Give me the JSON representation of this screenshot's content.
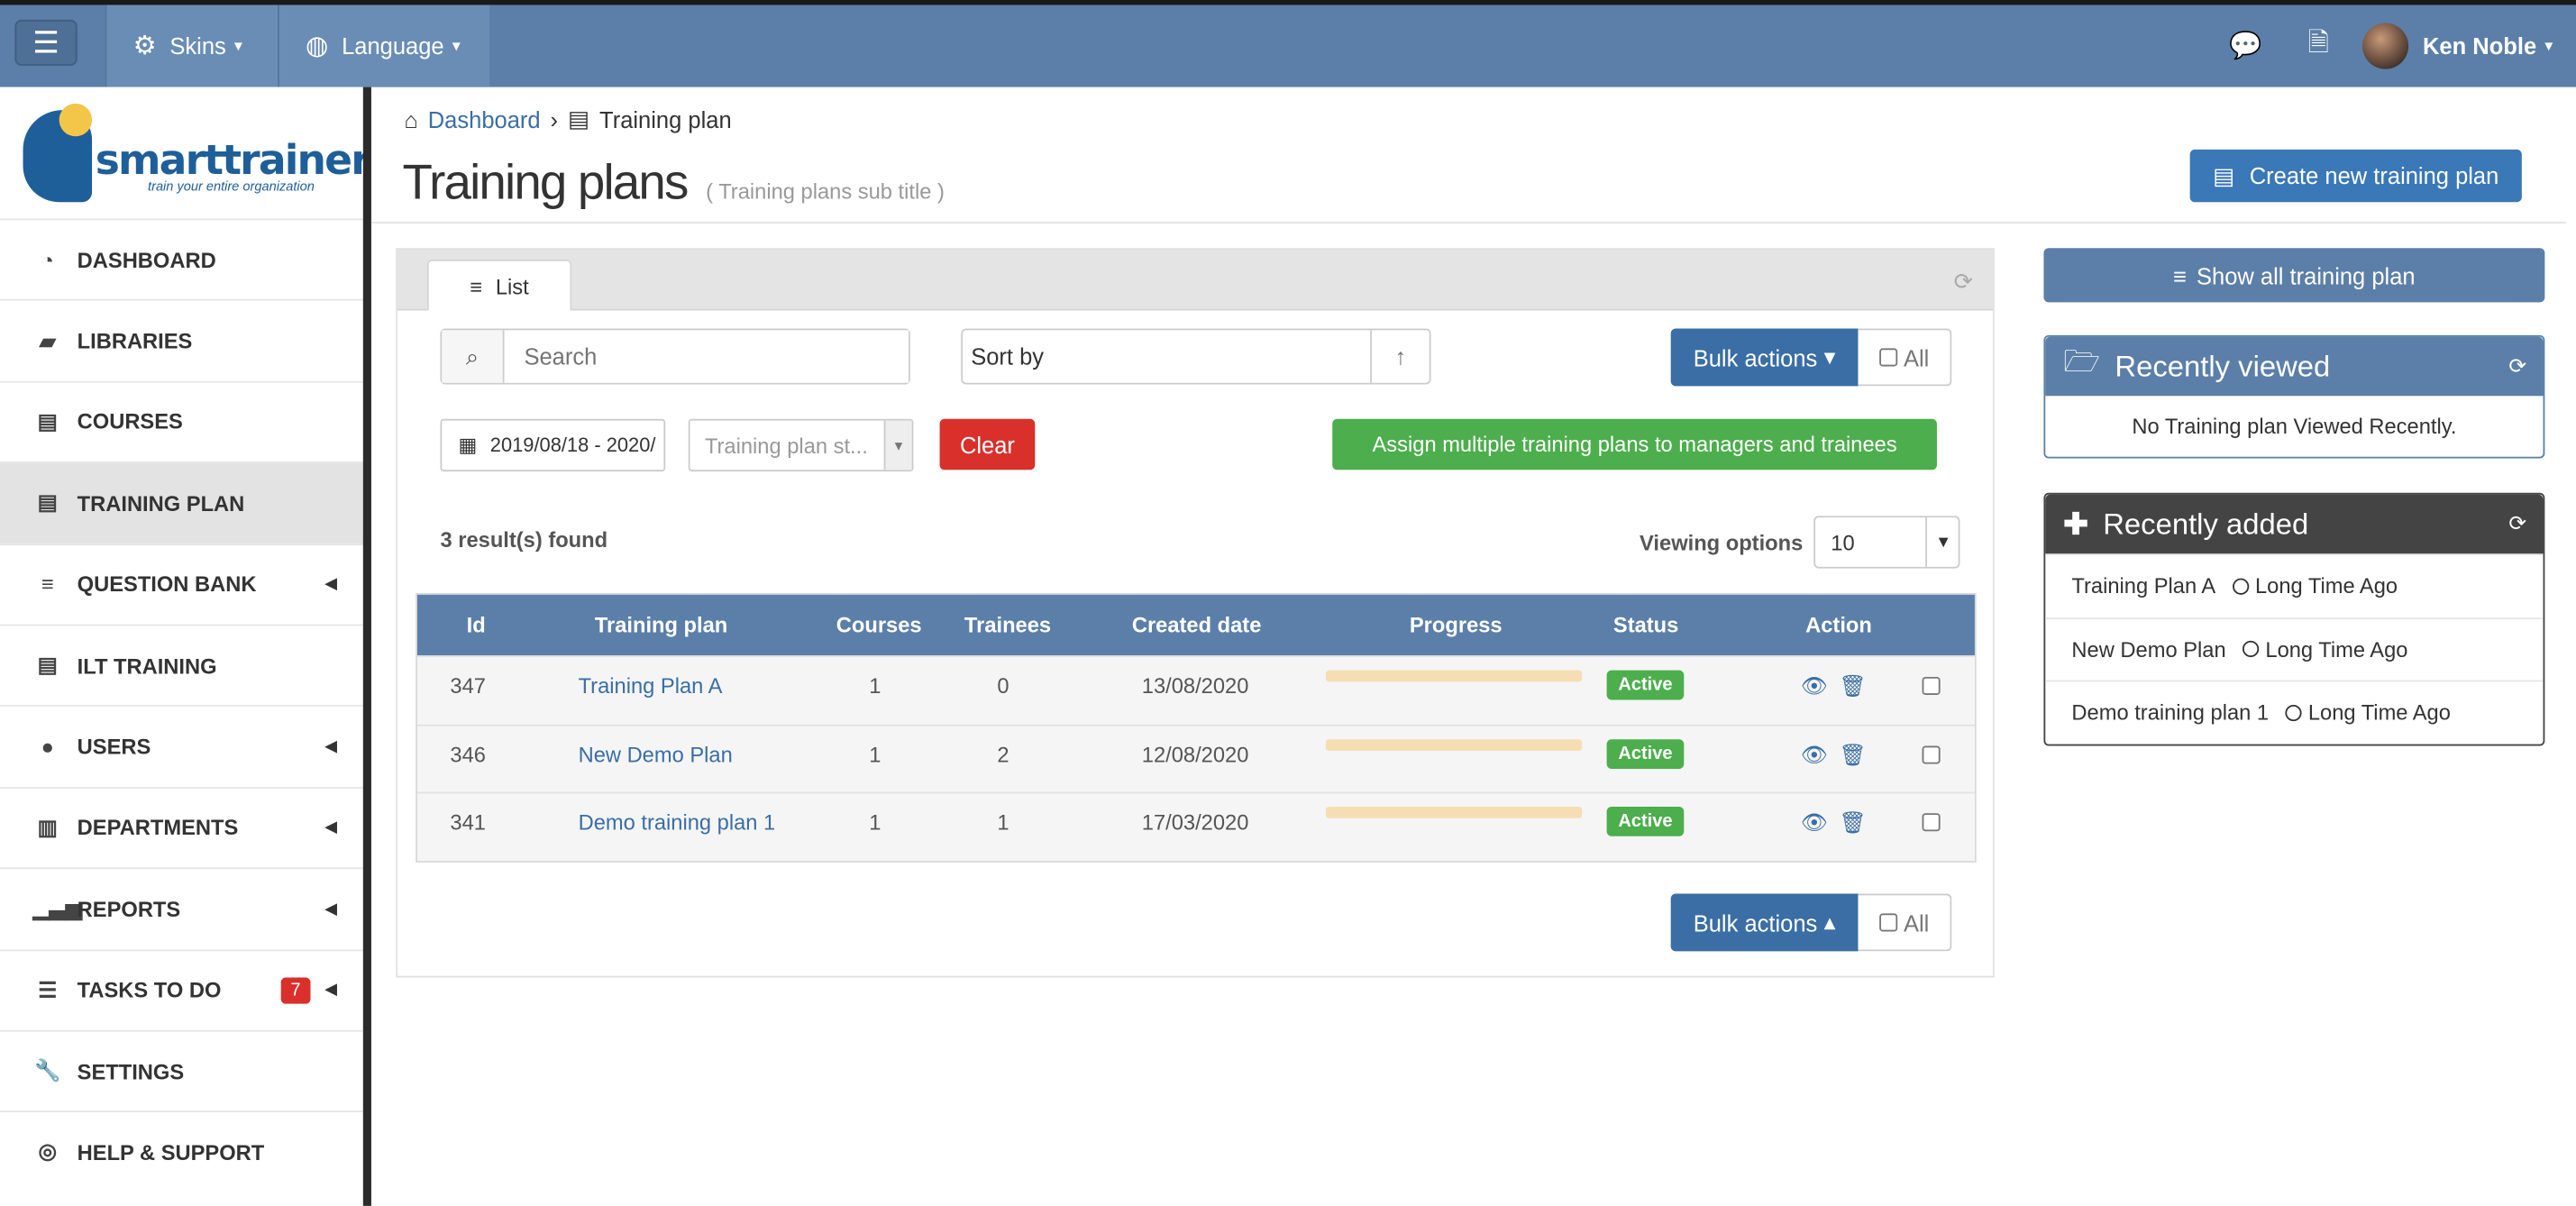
{
  "topbar": {
    "skins_label": "Skins",
    "language_label": "Language",
    "user_name": "Ken Noble"
  },
  "logo": {
    "name": "smarttrainer",
    "tagline": "train your entire organization"
  },
  "sidebar": {
    "items": [
      {
        "label": "DASHBOARD"
      },
      {
        "label": "LIBRARIES"
      },
      {
        "label": "COURSES"
      },
      {
        "label": "TRAINING PLAN"
      },
      {
        "label": "QUESTION BANK"
      },
      {
        "label": "ILT TRAINING"
      },
      {
        "label": "USERS"
      },
      {
        "label": "DEPARTMENTS"
      },
      {
        "label": "REPORTS"
      },
      {
        "label": "TASKS TO DO",
        "badge": "7"
      },
      {
        "label": "SETTINGS"
      },
      {
        "label": "HELP & SUPPORT"
      }
    ]
  },
  "breadcrumb": {
    "home": "Dashboard",
    "current": "Training plan"
  },
  "page": {
    "title": "Training plans",
    "subtitle": "( Training plans sub title )",
    "create_button": "Create new training plan"
  },
  "list": {
    "tab_label": "List",
    "search_placeholder": "Search",
    "sort_label": "Sort by",
    "bulk_label": "Bulk actions",
    "all_label": "All",
    "date_range": "2019/08/18 - 2020/",
    "status_placeholder": "Training plan st...",
    "clear_label": "Clear",
    "assign_label": "Assign multiple training plans to managers and trainees",
    "results_text": "3 result(s) found",
    "viewing_label": "Viewing options",
    "viewing_value": "10",
    "columns": [
      "Id",
      "Training plan",
      "Courses",
      "Trainees",
      "Created date",
      "Progress",
      "Status",
      "Action"
    ],
    "rows": [
      {
        "id": "347",
        "name": "Training Plan A",
        "courses": "1",
        "trainees": "0",
        "created": "13/08/2020",
        "progress": 0,
        "status": "Active"
      },
      {
        "id": "346",
        "name": "New Demo Plan",
        "courses": "1",
        "trainees": "2",
        "created": "12/08/2020",
        "progress": 0,
        "status": "Active"
      },
      {
        "id": "341",
        "name": "Demo training plan 1",
        "courses": "1",
        "trainees": "1",
        "created": "17/03/2020",
        "progress": 0,
        "status": "Active"
      }
    ]
  },
  "right": {
    "show_all": "Show all training plan",
    "recently_viewed_title": "Recently viewed",
    "recently_viewed_empty": "No Training plan Viewed Recently.",
    "recently_added_title": "Recently added",
    "recently_added": [
      {
        "name": "Training Plan A",
        "time": "Long Time Ago"
      },
      {
        "name": "New Demo Plan",
        "time": "Long Time Ago"
      },
      {
        "name": "Demo training plan 1",
        "time": "Long Time Ago"
      }
    ]
  },
  "colors": {
    "topbar": "#5b7fa8",
    "primary": "#3a78b7",
    "success": "#4cae4c",
    "danger": "#d9302b"
  }
}
